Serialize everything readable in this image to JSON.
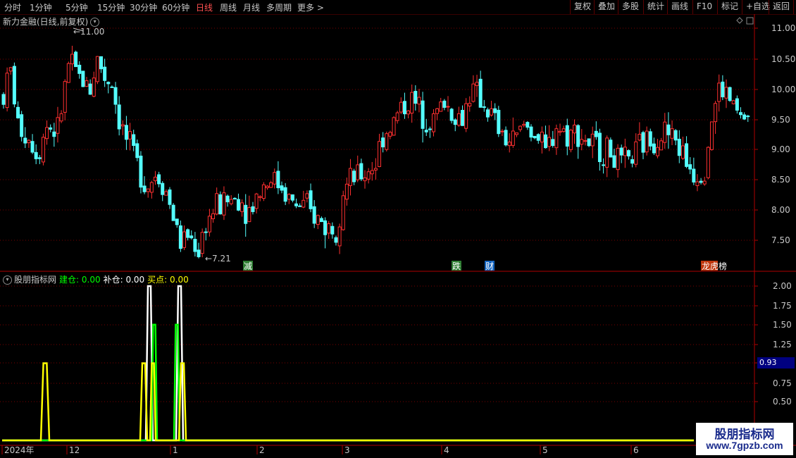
{
  "toolbar": {
    "periods": [
      "分时",
      "1分钟",
      "5分钟",
      "15分钟",
      "30分钟",
      "60分钟",
      "日线",
      "周线",
      "月线",
      "多周期",
      "更多 >"
    ],
    "active_period": "日线",
    "right_buttons": [
      "复权",
      "叠加",
      "多股",
      "统计",
      "画线",
      "F10",
      "标记",
      "+自选",
      "返回"
    ]
  },
  "main_pane": {
    "title": "新力金融(日线,前复权)",
    "high_marker": "11.00",
    "low_marker": "7.21",
    "y_ticks": [
      "11.00",
      "10.50",
      "10.00",
      "9.50",
      "9.00",
      "8.50",
      "8.00",
      "7.50"
    ],
    "event_tags": [
      {
        "text": "减",
        "color": "#ffffff",
        "bg": "#2e7d32"
      },
      {
        "text": "跌",
        "color": "#ffffff",
        "bg": "#2e7d32"
      },
      {
        "text": "财",
        "color": "#ffffff",
        "bg": "#1565c0"
      },
      {
        "text": "龙虎榜",
        "color": "#ffffff",
        "bg": "#bf360c"
      }
    ]
  },
  "indicator": {
    "name": "股朋指标网",
    "jiancang_label": "建仓: 0.00",
    "bucang_label": "补仓: 0.00",
    "maidian_label": "买点: 0.00",
    "jiancang_color": "#00ff00",
    "bucang_color": "#ffffff",
    "maidian_color": "#ffff00",
    "y_ticks": [
      "2.00",
      "1.75",
      "1.50",
      "1.25",
      "0.93",
      "0.75",
      "0.50"
    ],
    "current_value": "0.93"
  },
  "x_axis": {
    "labels": [
      "2024年",
      "12",
      "1",
      "2",
      "3",
      "4",
      "5",
      "6"
    ]
  },
  "watermark": {
    "line1": "股朋指标网",
    "line2": "www.7gpzb.com"
  },
  "colors": {
    "up": "#ff3030",
    "down": "#54ffff",
    "grid": "#7a0000"
  }
}
